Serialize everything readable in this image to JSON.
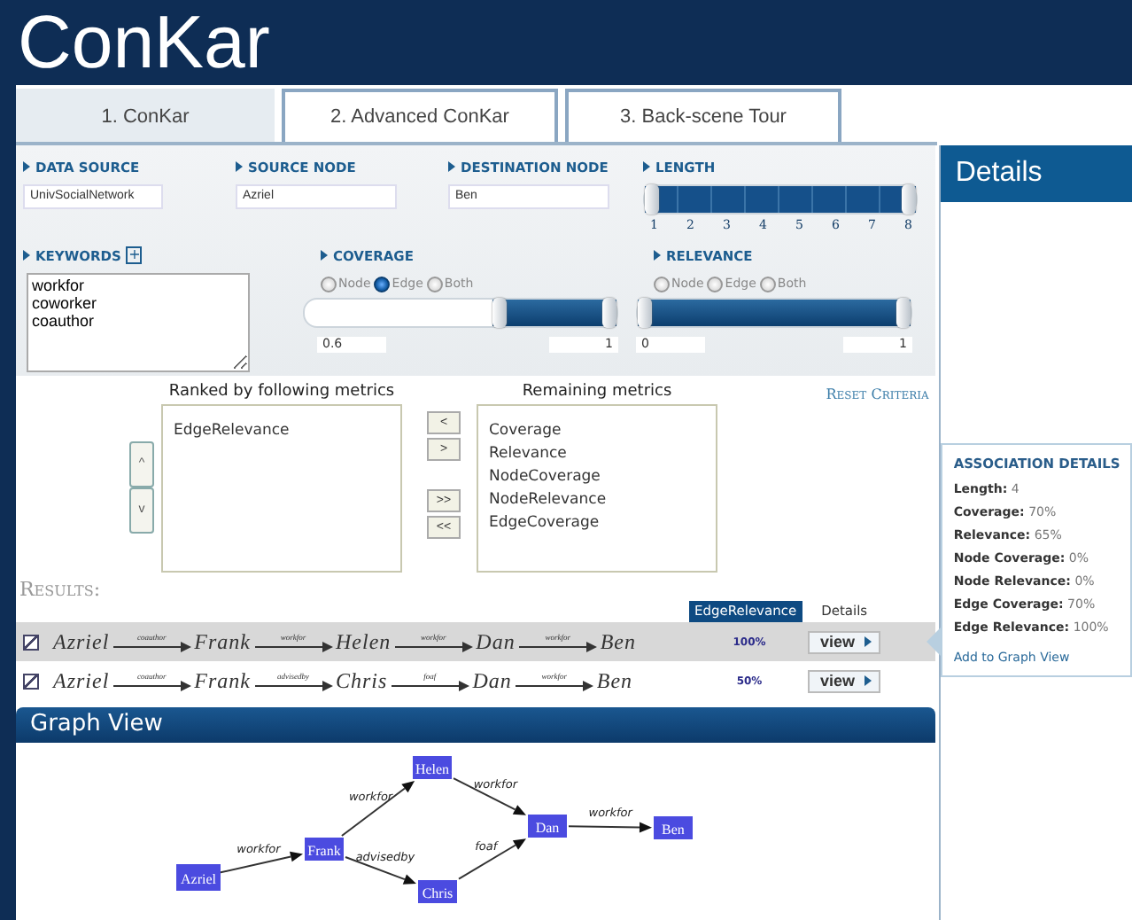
{
  "app": {
    "title": "ConKar"
  },
  "tabs": [
    {
      "label": "1. ConKar",
      "selected": true
    },
    {
      "label": "2. Advanced ConKar",
      "selected": false
    },
    {
      "label": "3. Back-scene Tour",
      "selected": false
    }
  ],
  "fields": [
    {
      "label": "DATA SOURCE",
      "value": "UnivSocialNetwork"
    },
    {
      "label": "SOURCE NODE",
      "value": "Azriel"
    },
    {
      "label": "DESTINATION NODE",
      "value": "Ben"
    }
  ],
  "length": {
    "label": "LENGTH",
    "thumbs": [
      {
        "level": 0
      },
      {
        "level": 1
      }
    ],
    "ticks": [
      "1",
      "2",
      "3",
      "4",
      "5",
      "6",
      "7",
      "8"
    ]
  },
  "keywords": {
    "label": "KEYWORDS",
    "add_button": "+",
    "value": "workfor\ncoworker\ncoauthor"
  },
  "coverage": {
    "label": "COVERAGE",
    "options": [
      {
        "label": "Node",
        "selected": false
      },
      {
        "label": "Edge",
        "selected": true
      },
      {
        "label": "Both",
        "selected": false
      }
    ],
    "thumbs": [
      {
        "level": 0.6
      },
      {
        "level": 1
      }
    ],
    "min_value": "0.6",
    "max_value": "1"
  },
  "relevance": {
    "label": "RELEVANCE",
    "options": [
      {
        "label": "Node",
        "selected": false
      },
      {
        "label": "Edge",
        "selected": false
      },
      {
        "label": "Both",
        "selected": false
      }
    ],
    "thumbs": [
      {
        "level": 0
      },
      {
        "level": 1
      }
    ],
    "min_value": "0",
    "max_value": "1"
  },
  "metrics": {
    "order_buttons": [
      "^",
      "v"
    ],
    "ranked_title": "Ranked by following metrics",
    "ranked": [
      "EdgeRelevance"
    ],
    "move_buttons": [
      "<",
      ">",
      ">>",
      "<<"
    ],
    "remaining_title": "Remaining metrics",
    "remaining": [
      "Coverage",
      "Relevance",
      "NodeCoverage",
      "NodeRelevance",
      "EdgeCoverage"
    ],
    "reset_link": "Reset Criteria"
  },
  "results": {
    "title": "Results:",
    "columns": [
      {
        "label": "EdgeRelevance",
        "selected": true
      },
      {
        "label": "Details",
        "selected": false
      }
    ],
    "rows": [
      {
        "checked": true,
        "selected": true,
        "nodes": [
          "Azriel",
          "Frank",
          "Helen",
          "Dan",
          "Ben"
        ],
        "edges": [
          "coauthor",
          "workfor",
          "workfor",
          "workfor"
        ],
        "score": "100%",
        "button": "view"
      },
      {
        "checked": true,
        "selected": false,
        "nodes": [
          "Azriel",
          "Frank",
          "Chris",
          "Dan",
          "Ben"
        ],
        "edges": [
          "coauthor",
          "advisedby",
          "foaf",
          "workfor"
        ],
        "score": "50%",
        "button": "view"
      }
    ]
  },
  "graph_view": {
    "title": "Graph View",
    "nodes": [
      "Azriel",
      "Frank",
      "Helen",
      "Chris",
      "Dan",
      "Ben"
    ],
    "edges": [
      {
        "label": "workfor"
      },
      {
        "label": "workfor"
      },
      {
        "label": "advisedby"
      },
      {
        "label": "workfor"
      },
      {
        "label": "foaf"
      },
      {
        "label": "workfor"
      }
    ]
  },
  "details": {
    "title": "Details",
    "section_title": "ASSOCIATION DETAILS",
    "items": [
      {
        "label": "Length:",
        "value": "4"
      },
      {
        "label": "Coverage:",
        "value": "70%"
      },
      {
        "label": "Relevance:",
        "value": "65%"
      },
      {
        "label": "Node Coverage:",
        "value": "0%"
      },
      {
        "label": "Node Relevance:",
        "value": "0%"
      },
      {
        "label": "Edge Coverage:",
        "value": "70%"
      },
      {
        "label": "Edge Relevance:",
        "value": "100%"
      }
    ],
    "link": "Add to Graph View"
  }
}
